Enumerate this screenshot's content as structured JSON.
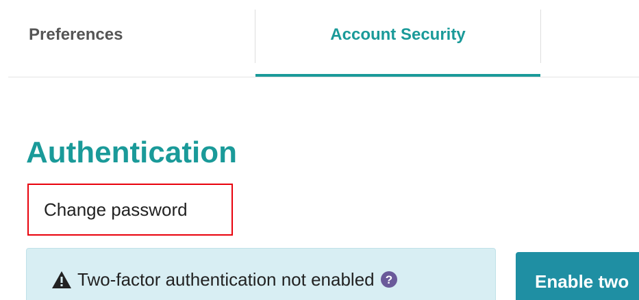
{
  "tabs": [
    {
      "label": "Preferences",
      "active": false
    },
    {
      "label": "Account Security",
      "active": true
    }
  ],
  "section": {
    "heading": "Authentication",
    "change_password_label": "Change password"
  },
  "twofa": {
    "status_text": "Two-factor authentication not enabled",
    "warning_icon": "warning-triangle-icon",
    "help_icon": "question-circle-icon",
    "enable_button_label": "Enable two"
  },
  "colors": {
    "accent": "#1a9a99",
    "tab_inactive": "#555555",
    "highlight_border": "#e8000b",
    "info_bg": "#d8eef3",
    "button_bg": "#1f8fa3",
    "help_icon": "#6a5a9a"
  }
}
